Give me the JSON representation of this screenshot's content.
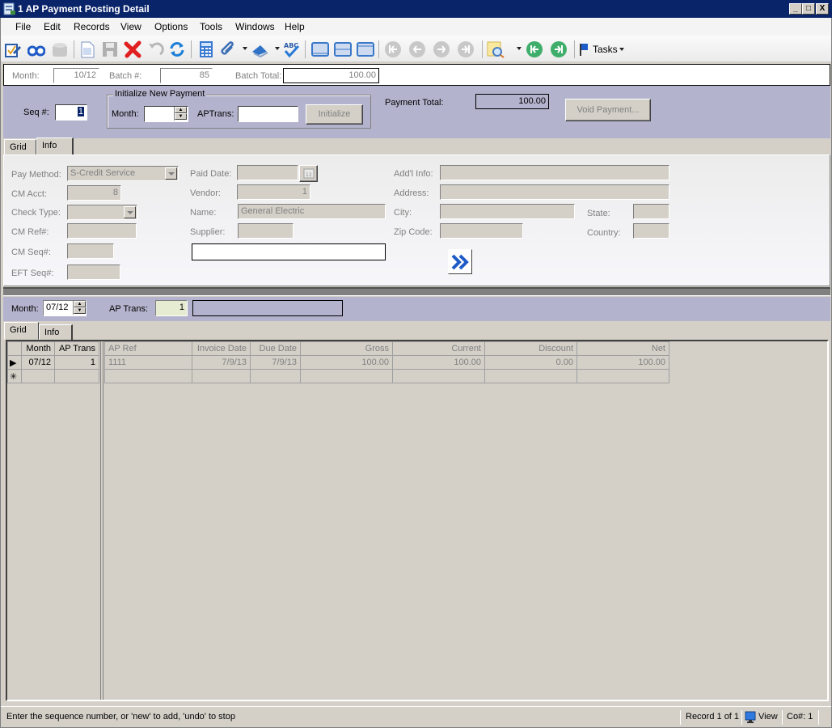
{
  "window": {
    "title": "1 AP Payment Posting Detail",
    "controls": [
      "_",
      "□",
      "X"
    ]
  },
  "menu": [
    "File",
    "Edit",
    "Records",
    "View",
    "Options",
    "Tools",
    "Windows",
    "Help"
  ],
  "toolbar": {
    "icons": [
      "edit-form-icon",
      "lookup-binoculars-icon",
      "notes-icon",
      "new-record-icon",
      "save-icon",
      "delete-icon",
      "undo-icon",
      "refresh-icon",
      "calculator-icon",
      "attachment-icon",
      "scan-icon",
      "spellcheck-icon",
      "layout-top-icon",
      "layout-middle-icon",
      "layout-bottom-icon",
      "first-record-icon",
      "previous-record-icon",
      "next-record-icon",
      "last-record-icon",
      "query-icon",
      "first-batch-icon",
      "last-batch-icon",
      "tasks-flag-icon"
    ],
    "tasks_label": "Tasks"
  },
  "batch": {
    "month_label": "Month:",
    "month_value": "10/12",
    "batch_label": "Batch #:",
    "batch_value": "85",
    "total_label": "Batch Total:",
    "total_value": "100.00"
  },
  "header": {
    "seq_label": "Seq #:",
    "seq_value": "1",
    "init_group_title": "Initialize New Payment",
    "init_month_label": "Month:",
    "init_month_value": "",
    "init_aptrans_label": "APTrans:",
    "init_aptrans_value": "",
    "initialize_button": "Initialize",
    "payment_total_label": "Payment Total:",
    "payment_total_value": "100.00",
    "void_button": "Void Payment..."
  },
  "upper_tabs": [
    "Grid",
    "Info"
  ],
  "info": {
    "pay_method_label": "Pay Method:",
    "pay_method_value": "S-Credit Service",
    "cm_acct_label": "CM Acct:",
    "cm_acct_value": "8",
    "check_type_label": "Check Type:",
    "check_type_value": "",
    "cm_ref_label": "CM Ref#:",
    "cm_ref_value": "",
    "cm_seq_label": "CM Seq#:",
    "cm_seq_value": "",
    "eft_seq_label": "EFT Seq#:",
    "eft_seq_value": "",
    "paid_date_label": "Paid Date:",
    "paid_date_value": "",
    "vendor_label": "Vendor:",
    "vendor_value": "1",
    "name_label": "Name:",
    "name_value": "General Electric",
    "supplier_label": "Supplier:",
    "supplier_value": "",
    "supplier_desc_value": "",
    "addl_info_label": "Add'l Info:",
    "addl_info_value": "",
    "address_label": "Address:",
    "address_value": "",
    "city_label": "City:",
    "city_value": "",
    "state_label": "State:",
    "state_value": "",
    "zip_label": "Zip Code:",
    "zip_value": "",
    "country_label": "Country:",
    "country_value": ""
  },
  "detail_header": {
    "month_label": "Month:",
    "month_value": "07/12",
    "ap_trans_label": "AP Trans:",
    "ap_trans_value": "1",
    "ap_trans_desc": ""
  },
  "lower_tabs": [
    "Grid",
    "Info"
  ],
  "grid": {
    "frozen_columns": [
      "Month",
      "AP Trans"
    ],
    "columns": [
      "AP Ref",
      "Invoice Date",
      "Due Date",
      "Gross",
      "Current",
      "Discount",
      "Net"
    ],
    "rows": [
      {
        "indicator": "current",
        "month": "07/12",
        "ap_trans": "1",
        "ap_ref": "1111",
        "invoice_date": "7/9/13",
        "due_date": "7/9/13",
        "gross": "100.00",
        "current": "100.00",
        "discount": "0.00",
        "net": "100.00"
      },
      {
        "indicator": "new",
        "month": "",
        "ap_trans": "",
        "ap_ref": "",
        "invoice_date": "",
        "due_date": "",
        "gross": "",
        "current": "",
        "discount": "",
        "net": ""
      }
    ]
  },
  "status": {
    "message": "Enter the sequence number, or 'new' to add, 'undo' to stop",
    "record": "Record 1 of 1",
    "mode": "View",
    "company": "Co#: 1"
  }
}
